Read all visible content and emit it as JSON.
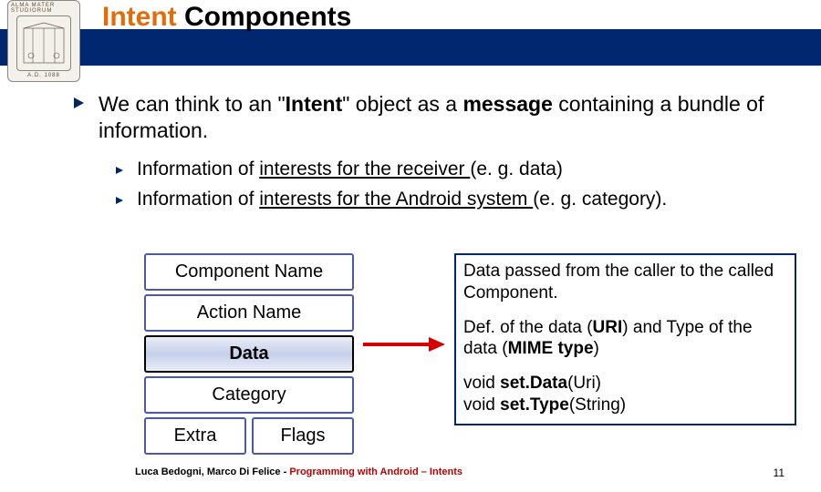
{
  "title_orange": "Intent",
  "title_rest": " Components",
  "seal": {
    "top": "ALMA MATER STUDIORUM",
    "bot": "A.D. 1088"
  },
  "main_bullet_pre": "We can think to an \"",
  "main_bullet_bold1": "Intent",
  "main_bullet_mid": "\" object as a ",
  "main_bullet_bold2": "message",
  "main_bullet_post": " containing a bundle of information.",
  "sub1_pre": "Information of ",
  "sub1_ul": "interests for the receiver ",
  "sub1_post": "(e. g. data)",
  "sub2_pre": "Information of ",
  "sub2_ul": "interests for the Android system ",
  "sub2_post": "(e. g. category).",
  "boxes": {
    "b1": "Component Name",
    "b2": "Action Name",
    "b3": "Data",
    "b4": "Category",
    "b5a": "Extra",
    "b5b": "Flags"
  },
  "desc": {
    "p1": "Data passed from the caller to the called Component.",
    "p2_pre": "Def. of the data (",
    "p2_b1": "URI",
    "p2_mid": ") and Type of the data (",
    "p2_b2": "MIME type",
    "p2_post": ")",
    "p3a_pre": "void ",
    "p3a_b": "set.Data",
    "p3a_post": "(Uri)",
    "p3b_pre": "void ",
    "p3b_b": "set.Type",
    "p3b_post": "(String)"
  },
  "footer": {
    "authors": "Luca Bedogni, Marco Di Felice",
    "dash": " - ",
    "course": "Programming with Android – Intents",
    "page": "11"
  }
}
